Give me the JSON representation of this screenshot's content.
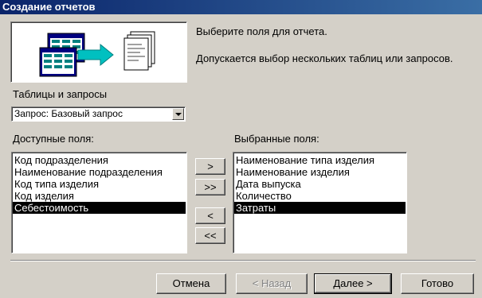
{
  "window": {
    "title": "Создание отчетов"
  },
  "intro": {
    "line1": "Выберите поля для отчета.",
    "line2": "Допускается выбор нескольких таблиц или запросов."
  },
  "source": {
    "label": "Таблицы и запросы",
    "value": "Запрос: Базовый запрос"
  },
  "available": {
    "label": "Доступные поля:",
    "items": [
      "Код подразделения",
      "Наименование подразделения",
      "Код типа изделия",
      "Код изделия",
      "Себестоимость"
    ],
    "selected_index": 4
  },
  "chosen": {
    "label": "Выбранные поля:",
    "items": [
      "Наименование типа изделия",
      "Наименование изделия",
      "Дата выпуска",
      "Количество",
      "Затраты"
    ],
    "selected_index": 4
  },
  "move": {
    "one_right": ">",
    "all_right": ">>",
    "one_left": "<",
    "all_left": "<<"
  },
  "buttons": {
    "cancel": "Отмена",
    "back": "< Назад",
    "next": "Далее >",
    "finish": "Готово"
  },
  "colors": {
    "titlebar": "#0a246a",
    "face": "#d4d0c8",
    "arrow": "#00c0c0",
    "selection": "#000000"
  }
}
